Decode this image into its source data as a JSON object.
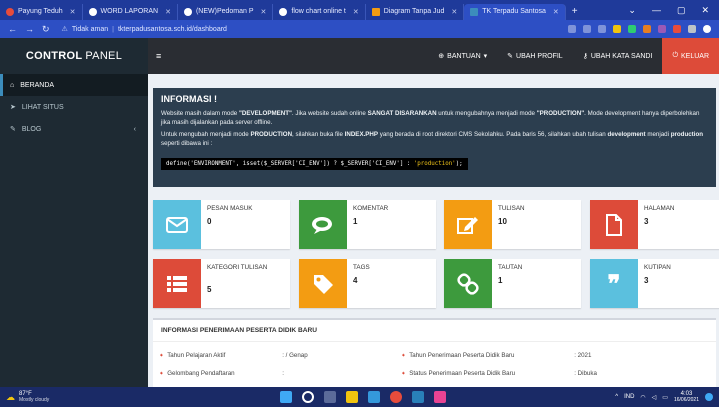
{
  "browser": {
    "tabs": [
      {
        "label": "Payung Teduh",
        "color": "#e74c3c"
      },
      {
        "label": "WORD LAPORAN",
        "color": "#ffffff"
      },
      {
        "label": "(NEW)Pedoman P",
        "color": "#ffffff"
      },
      {
        "label": "flow chart online t",
        "color": "#ffffff"
      },
      {
        "label": "Diagram Tanpa Jud",
        "color": "#f39c12"
      },
      {
        "label": "TK Terpadu Santosa",
        "color": "#3c8dbc"
      }
    ],
    "security": "Tidak aman",
    "url": "tkterpadusantosa.sch.id/dashboard"
  },
  "header": {
    "brand_bold": "CONTROL",
    "brand_rest": "PANEL",
    "menu": [
      {
        "label": "BANTUAN",
        "icon": "help-icon",
        "caret": "▾"
      },
      {
        "label": "UBAH PROFIL",
        "icon": "edit-icon",
        "caret": ""
      },
      {
        "label": "UBAH KATA SANDI",
        "icon": "key-icon",
        "caret": ""
      }
    ],
    "logout": "KELUAR"
  },
  "sidebar": {
    "items": [
      {
        "label": "BERANDA",
        "icon": "home-icon"
      },
      {
        "label": "LIHAT SITUS",
        "icon": "send-icon"
      },
      {
        "label": "BLOG",
        "icon": "blog-icon"
      }
    ]
  },
  "info": {
    "title": "INFORMASI !",
    "p1_a": "Website masih dalam mode ",
    "p1_b": "\"DEVELOPMENT\"",
    "p1_c": ". Jika website sudah online ",
    "p1_d": "SANGAT DISARANKAN",
    "p1_e": " untuk mengubahnya menjadi mode ",
    "p1_f": "\"PRODUCTION\"",
    "p1_g": ". Mode development hanya diperbolehkan jika masih dijalankan pada server offline.",
    "p2_a": "Untuk mengubah menjadi mode ",
    "p2_b": "PRODUCTION",
    "p2_c": ", silahkan buka file ",
    "p2_d": "INDEX.PHP",
    "p2_e": " yang berada di root direktori CMS Sekolahku. Pada baris 56, silahkan ubah tulisan ",
    "p2_f": "development",
    "p2_g": " menjadi ",
    "p2_h": "production",
    "p2_i": " seperti dibawa ini :",
    "code_a": "define('ENVIRONMENT', isset($_SERVER['CI_ENV']) ? $_SERVER['CI_ENV'] : ",
    "code_b": "'production'",
    "code_c": ");"
  },
  "stats": [
    {
      "label": "PESAN MASUK",
      "value": "0",
      "icon": "envelope-icon",
      "color": "#5bc0de"
    },
    {
      "label": "KOMENTAR",
      "value": "1",
      "icon": "comments-icon",
      "color": "#3d9a3d"
    },
    {
      "label": "TULISAN",
      "value": "10",
      "icon": "pencil-icon",
      "color": "#f39c12"
    },
    {
      "label": "HALAMAN",
      "value": "3",
      "icon": "file-icon",
      "color": "#dd4b39"
    },
    {
      "label": "KATEGORI TULISAN",
      "value": "5",
      "icon": "list-icon",
      "color": "#dd4b39"
    },
    {
      "label": "TAGS",
      "value": "4",
      "icon": "tag-icon",
      "color": "#f39c12"
    },
    {
      "label": "TAUTAN",
      "value": "1",
      "icon": "link-icon",
      "color": "#3d9a3d"
    },
    {
      "label": "KUTIPAN",
      "value": "3",
      "icon": "quote-icon",
      "color": "#5bc0de"
    }
  ],
  "admission": {
    "title": "INFORMASI PENERIMAAN PESERTA DIDIK BARU",
    "rows": [
      {
        "label": "Tahun Pelajaran Aktif",
        "value": ": / Genap"
      },
      {
        "label": "Tahun Penerimaan Peserta Didik Baru",
        "value": ": 2021"
      },
      {
        "label": "Gelombang Pendaftaran",
        "value": ":"
      },
      {
        "label": "Status Penerimaan Peserta Didik Baru",
        "value": ": Dibuka"
      }
    ]
  },
  "taskbar": {
    "temp": "87°F",
    "weather": "Mostly cloudy",
    "lang": "IND",
    "time": "4:03",
    "date": "16/06/2021"
  }
}
